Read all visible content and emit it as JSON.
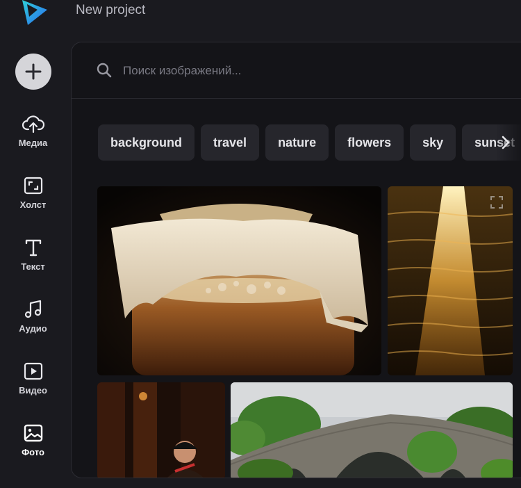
{
  "header": {
    "project_title": "New project"
  },
  "sidebar": {
    "add_icon": "plus-icon",
    "items": [
      {
        "label": "Медиа",
        "icon": "cloud-upload-icon"
      },
      {
        "label": "Холст",
        "icon": "canvas-resize-icon"
      },
      {
        "label": "Текст",
        "icon": "text-icon"
      },
      {
        "label": "Аудио",
        "icon": "music-note-icon"
      },
      {
        "label": "Видео",
        "icon": "video-play-icon"
      },
      {
        "label": "Фото",
        "icon": "image-icon",
        "active": true
      }
    ]
  },
  "search": {
    "placeholder": "Поиск изображений...",
    "value": ""
  },
  "tags": [
    "background",
    "travel",
    "nature",
    "flowers",
    "sky",
    "sunset"
  ],
  "colors": {
    "background": "#1a1a1f",
    "panel": "#141418",
    "chip": "#26262c",
    "logo_cyan": "#2fd0d8",
    "logo_blue": "#2a6cf0"
  },
  "images": [
    {
      "subject": "jar-with-cloth-cover"
    },
    {
      "subject": "sunlight-on-water"
    },
    {
      "subject": "person-in-dark-room"
    },
    {
      "subject": "stone-arch-bridge"
    }
  ]
}
